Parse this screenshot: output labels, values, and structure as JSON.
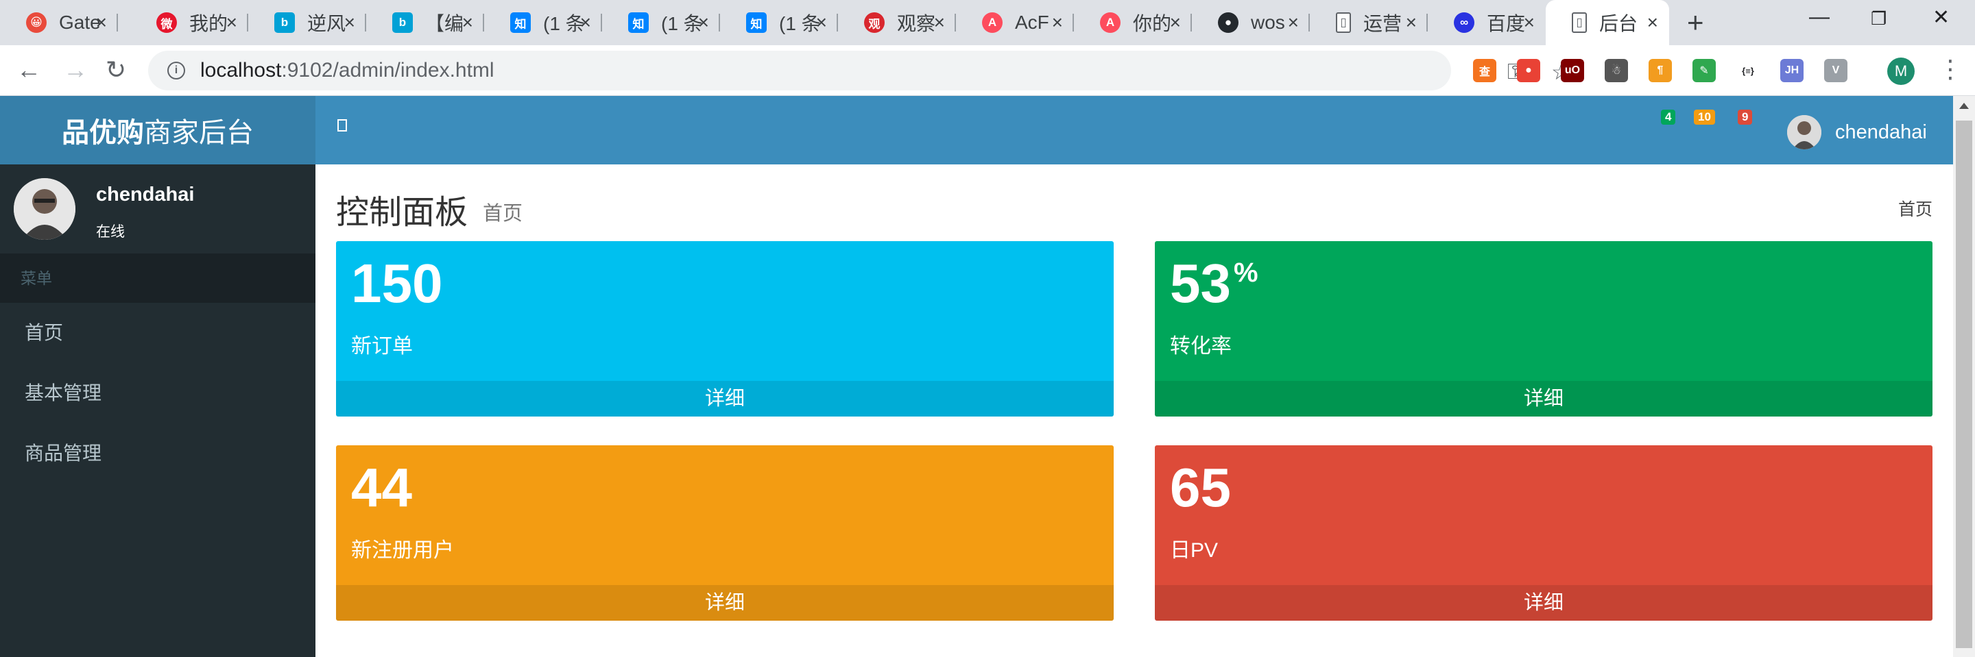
{
  "browser": {
    "tabs": [
      {
        "title": "Gate",
        "favicon_color": "#e94b3c",
        "favicon_glyph": "😀"
      },
      {
        "title": "我的",
        "favicon_color": "#e6162d",
        "favicon_glyph": "微"
      },
      {
        "title": "逆风",
        "favicon_color": "#00a1d6",
        "favicon_glyph": "b"
      },
      {
        "title": "【编",
        "favicon_color": "#00a1d6",
        "favicon_glyph": "b"
      },
      {
        "title": "(1 条",
        "favicon_color": "#0084ff",
        "favicon_glyph": "知"
      },
      {
        "title": "(1 条",
        "favicon_color": "#0084ff",
        "favicon_glyph": "知"
      },
      {
        "title": "(1 条",
        "favicon_color": "#0084ff",
        "favicon_glyph": "知"
      },
      {
        "title": "观察",
        "favicon_color": "#d9272e",
        "favicon_glyph": "观"
      },
      {
        "title": "AcF",
        "favicon_color": "#fd4c5d",
        "favicon_glyph": "A"
      },
      {
        "title": "你的",
        "favicon_color": "#fd4c5d",
        "favicon_glyph": "A"
      },
      {
        "title": "wos",
        "favicon_color": "#24292e",
        "favicon_glyph": "●"
      },
      {
        "title": "运营",
        "favicon_color": "#ffffff",
        "favicon_glyph": "▯"
      },
      {
        "title": "百度",
        "favicon_color": "#2932e1",
        "favicon_glyph": "∞"
      },
      {
        "title": "后台",
        "favicon_color": "#ffffff",
        "favicon_glyph": "▯"
      }
    ],
    "new_tab_label": "+",
    "url_host": "localhost",
    "url_path": ":9102/admin/index.html",
    "profile_initial": "M",
    "extensions": [
      {
        "glyph": "查",
        "color": "#f4731f"
      },
      {
        "glyph": "●",
        "color": "#e94235"
      },
      {
        "glyph": "uO",
        "color": "#800000"
      },
      {
        "glyph": "☃",
        "color": "#555555"
      },
      {
        "glyph": "¶",
        "color": "#f29c1f"
      },
      {
        "glyph": "✎",
        "color": "#2fa84f"
      },
      {
        "glyph": "{≡}",
        "color": "#ffffff"
      },
      {
        "glyph": "JH",
        "color": "#6c7bd6"
      },
      {
        "glyph": "V",
        "color": "#9aa0a6"
      }
    ]
  },
  "admin": {
    "logo_bold": "品优购",
    "logo_rest": "商家后台",
    "badges": [
      {
        "value": "4",
        "color": "#00a65a"
      },
      {
        "value": "10",
        "color": "#f39c12"
      },
      {
        "value": "9",
        "color": "#dd4b39"
      }
    ],
    "user_name": "chendahai",
    "user_status": "在线",
    "menu_header": "菜单",
    "menu": [
      "首页",
      "基本管理",
      "商品管理"
    ],
    "page_title": "控制面板",
    "page_subtitle": "首页",
    "breadcrumb": "首页",
    "cards": [
      {
        "value": "150",
        "suffix": "",
        "label": "新订单",
        "footer": "详细",
        "color": "#00c0ef"
      },
      {
        "value": "53",
        "suffix": "%",
        "label": "转化率",
        "footer": "详细",
        "color": "#00a65a"
      },
      {
        "value": "44",
        "suffix": "",
        "label": "新注册用户",
        "footer": "详细",
        "color": "#f39c12"
      },
      {
        "value": "65",
        "suffix": "",
        "label": "日PV",
        "footer": "详细",
        "color": "#dd4b39"
      }
    ]
  }
}
